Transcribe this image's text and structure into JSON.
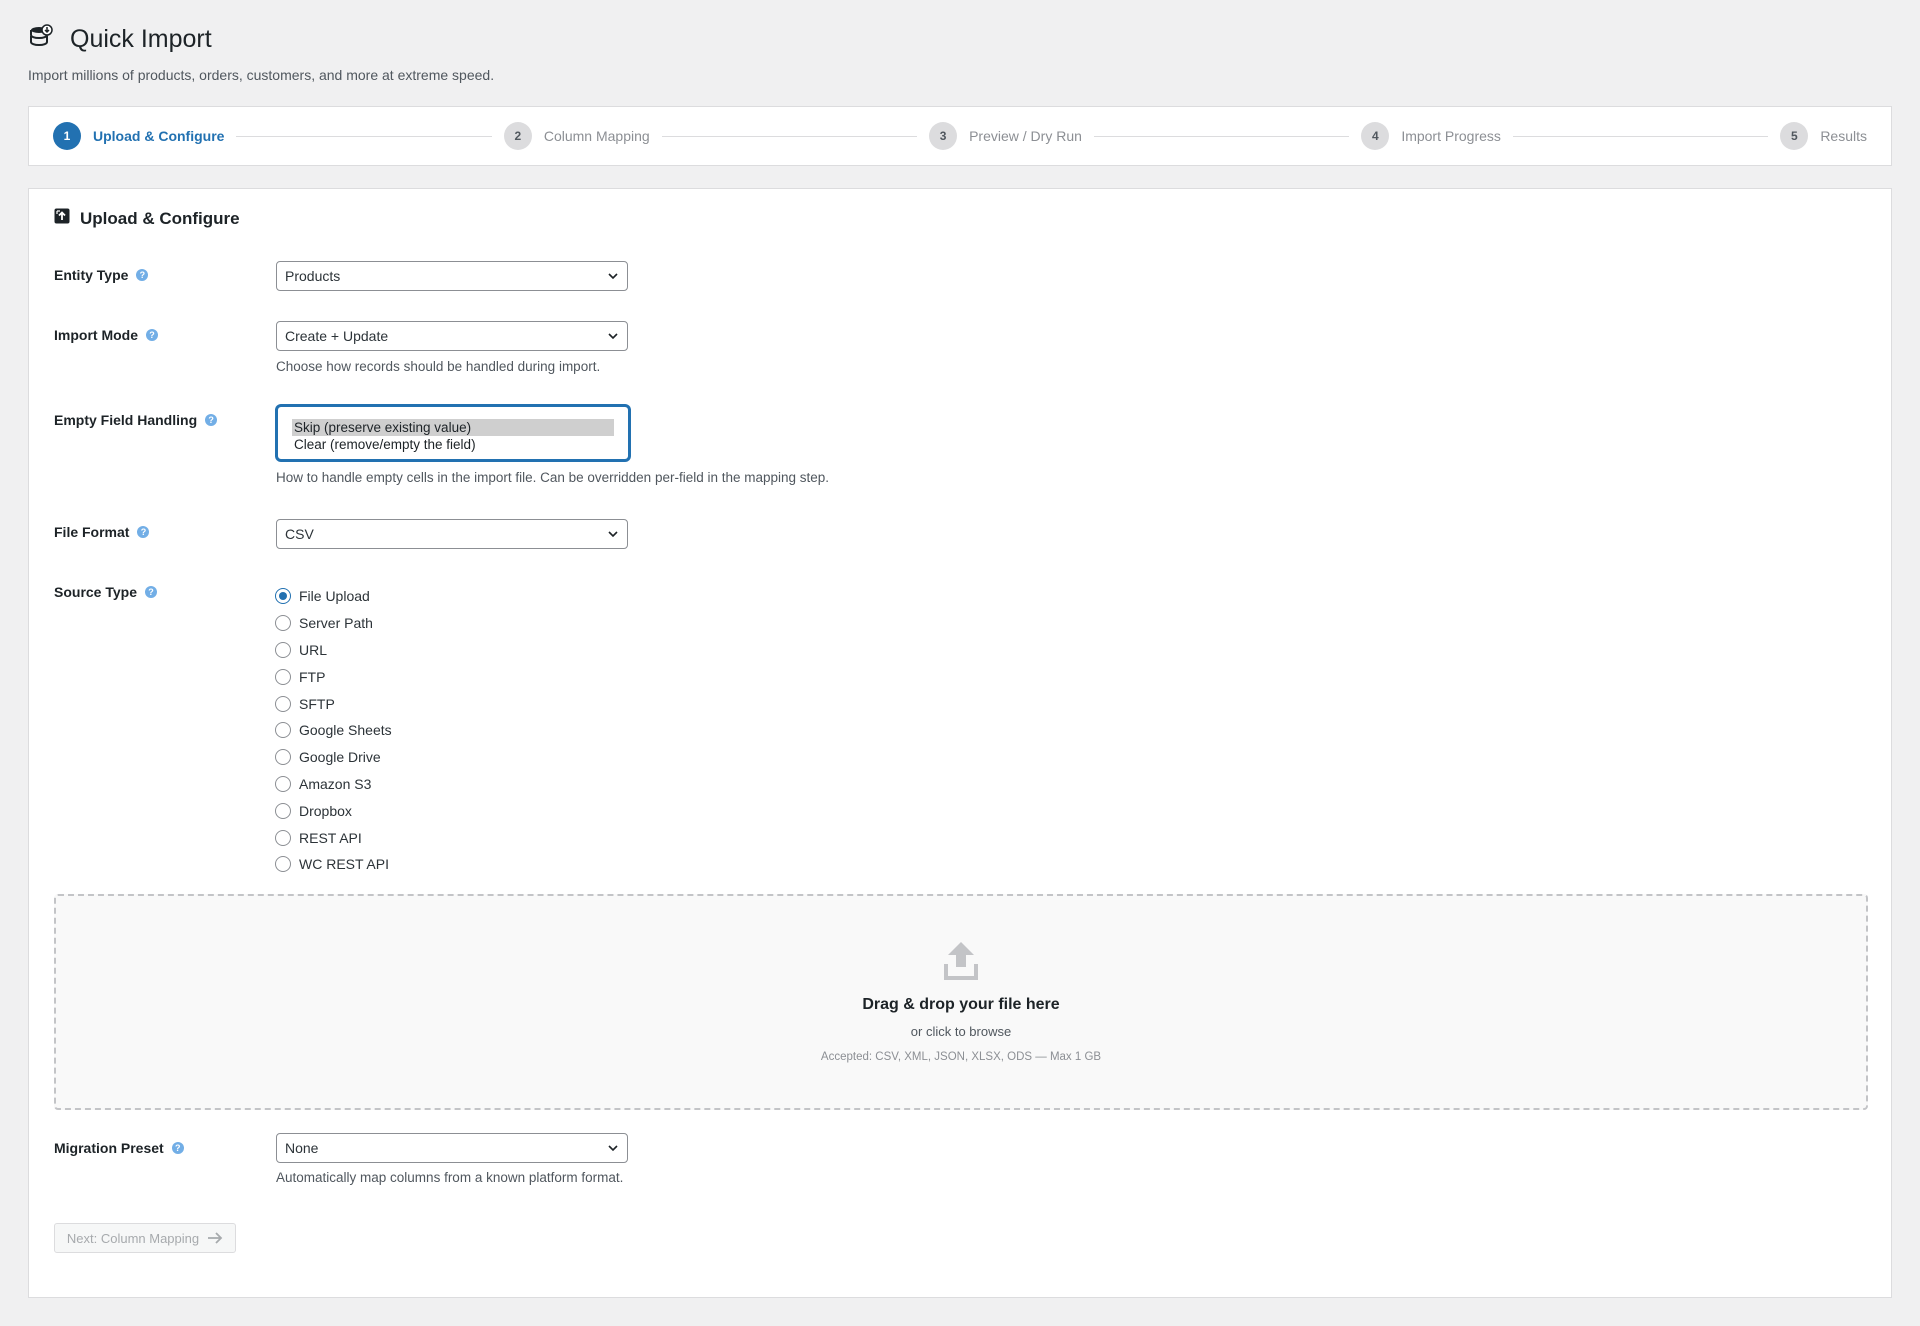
{
  "header": {
    "title": "Quick Import",
    "description": "Import millions of products, orders, customers, and more at extreme speed."
  },
  "steps": [
    {
      "num": "1",
      "label": "Upload & Configure"
    },
    {
      "num": "2",
      "label": "Column Mapping"
    },
    {
      "num": "3",
      "label": "Preview / Dry Run"
    },
    {
      "num": "4",
      "label": "Import Progress"
    },
    {
      "num": "5",
      "label": "Results"
    }
  ],
  "card": {
    "title": "Upload & Configure"
  },
  "form": {
    "entity_type": {
      "label": "Entity Type",
      "value": "Products"
    },
    "import_mode": {
      "label": "Import Mode",
      "value": "Create + Update",
      "description": "Choose how records should be handled during import."
    },
    "empty_field": {
      "label": "Empty Field Handling",
      "options": [
        "Skip (preserve existing value)",
        "Clear (remove/empty the field)"
      ],
      "description": "How to handle empty cells in the import file. Can be overridden per-field in the mapping step."
    },
    "file_format": {
      "label": "File Format",
      "value": "CSV"
    },
    "source_type": {
      "label": "Source Type",
      "options": [
        "File Upload",
        "Server Path",
        "URL",
        "FTP",
        "SFTP",
        "Google Sheets",
        "Google Drive",
        "Amazon S3",
        "Dropbox",
        "REST API",
        "WC REST API"
      ],
      "selected": "File Upload"
    },
    "migration_preset": {
      "label": "Migration Preset",
      "value": "None",
      "description": "Automatically map columns from a known platform format."
    }
  },
  "dropzone": {
    "title": "Drag & drop your file here",
    "subtitle": "or click to browse",
    "accepted": "Accepted: CSV, XML, JSON, XLSX, ODS — Max 1 GB"
  },
  "next_button": {
    "label": "Next: Column Mapping"
  },
  "colors": {
    "accent": "#2271b1",
    "help": "#72aee6",
    "border": "#dcdcde"
  }
}
